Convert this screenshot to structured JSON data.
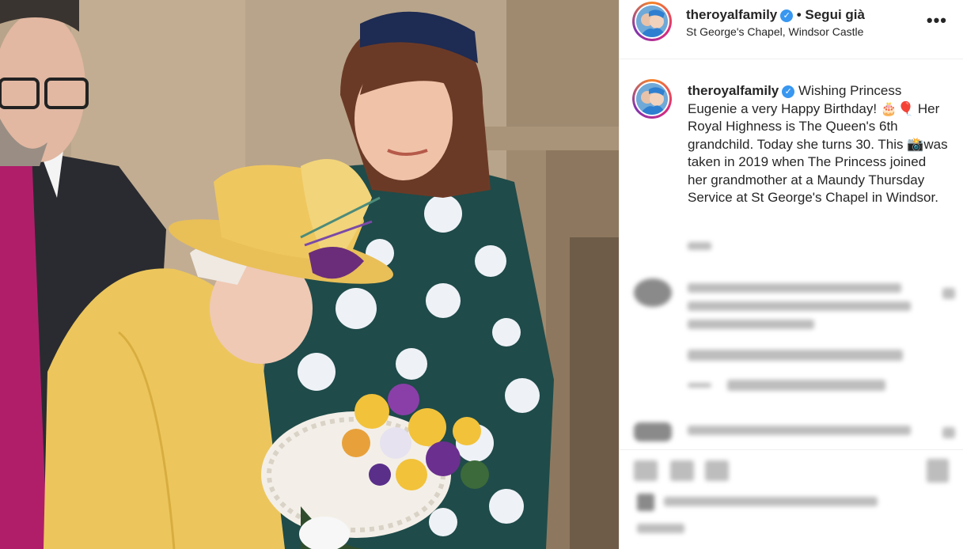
{
  "post": {
    "username": "theroyalfamily",
    "verified_mark": "✓",
    "follow_label": "• Segui già",
    "location": "St George's Chapel, Windsor Castle",
    "more_label": "•••"
  },
  "caption": {
    "username": "theroyalfamily",
    "text": "Wishing Princess Eugenie a very Happy Birthday! 🎂🎈 Her Royal Highness is The Queen's 6th grandchild. Today she turns 30. This 📸was taken in 2019 when The Princess joined her grandmother at a Maundy Thursday Service at St George's Chapel in Windsor."
  },
  "icons": {
    "verified": "verified-badge-icon",
    "more": "more-options-icon",
    "like": "heart-icon",
    "comment": "comment-icon",
    "share": "share-icon",
    "save": "bookmark-icon"
  },
  "colors": {
    "verified": "#3897f0",
    "ring_start": "#f58529",
    "ring_mid": "#dd2a7b",
    "ring_end": "#8134af",
    "text": "#262626"
  }
}
